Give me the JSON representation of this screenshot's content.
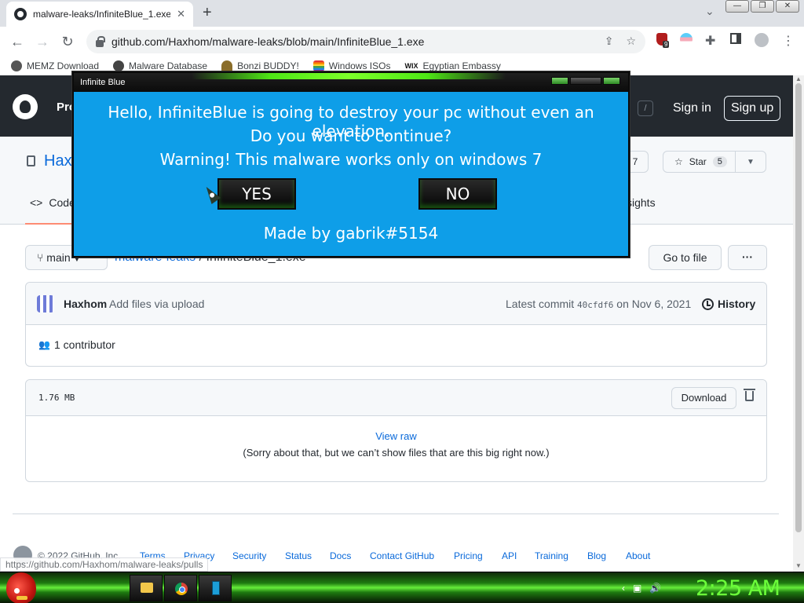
{
  "browser": {
    "tab_title": "malware-leaks/InfiniteBlue_1.exe",
    "tab_close": "✕",
    "new_tab": "+",
    "tab_search": "⌄",
    "window_buttons": [
      "—",
      "❐",
      "✕"
    ],
    "url": "github.com/Haxhom/malware-leaks/blob/main/InfiniteBlue_1.exe",
    "nav": {
      "back": "←",
      "forward": "→",
      "reload": "↻"
    },
    "omnibox_icons": {
      "share": "⇪",
      "bookmark": "☆"
    },
    "menu": "⋮",
    "extension_badge": "9",
    "bookmarks": [
      {
        "label": "MEMZ Download",
        "color": "#555555"
      },
      {
        "label": "Malware Database",
        "color": "#444444"
      },
      {
        "label": "Bonzi BUDDY!",
        "color": "#8a6d2a"
      },
      {
        "label": "Windows ISOs",
        "color": "#c0392b"
      },
      {
        "label": "Egyptian Embassy",
        "color": "#111111"
      }
    ],
    "status_url": "https://github.com/Haxhom/malware-leaks/pulls"
  },
  "github": {
    "header": {
      "product": "Pro",
      "slash": "/",
      "signin": "Sign in",
      "signup": "Sign up"
    },
    "repo_name": "Hax",
    "watch_count": "7",
    "star_label": "Star",
    "star_count": "5",
    "code_tab": "Code",
    "insights_tab": "sights",
    "branch": "main",
    "breadcrumb_repo": "malware-leaks",
    "breadcrumb_sep": "/",
    "breadcrumb_file": "InfiniteBlue_1.exe",
    "goto_file": "Go to file",
    "more": "···",
    "commit": {
      "author": "Haxhom",
      "message": "Add files via upload",
      "latest_label": "Latest commit",
      "sha": "40cfdf6",
      "date": "on Nov 6, 2021",
      "history": "History"
    },
    "contributors": "1 contributor",
    "file": {
      "size": "1.76 MB",
      "download": "Download",
      "view_raw": "View raw",
      "too_big": "(Sorry about that, but we can’t show files that are this big right now.)"
    },
    "footer": {
      "copyright": "© 2022 GitHub, Inc.",
      "links": [
        "Terms",
        "Privacy",
        "Security",
        "Status",
        "Docs",
        "Contact GitHub",
        "Pricing",
        "API",
        "Training",
        "Blog",
        "About"
      ]
    }
  },
  "dialog": {
    "title": "Infinite Blue",
    "line1": "Hello, InfiniteBlue is going to destroy your pc without even an elevation.",
    "line2": "Do you want to continue?",
    "line3": "Warning! This malware works only on windows 7",
    "yes": "YES",
    "no": "NO",
    "footer": "Made by gabrik#5154"
  },
  "taskbar": {
    "clock": "2:25 AM",
    "tray": [
      "‹",
      "▣",
      "🔊"
    ]
  }
}
